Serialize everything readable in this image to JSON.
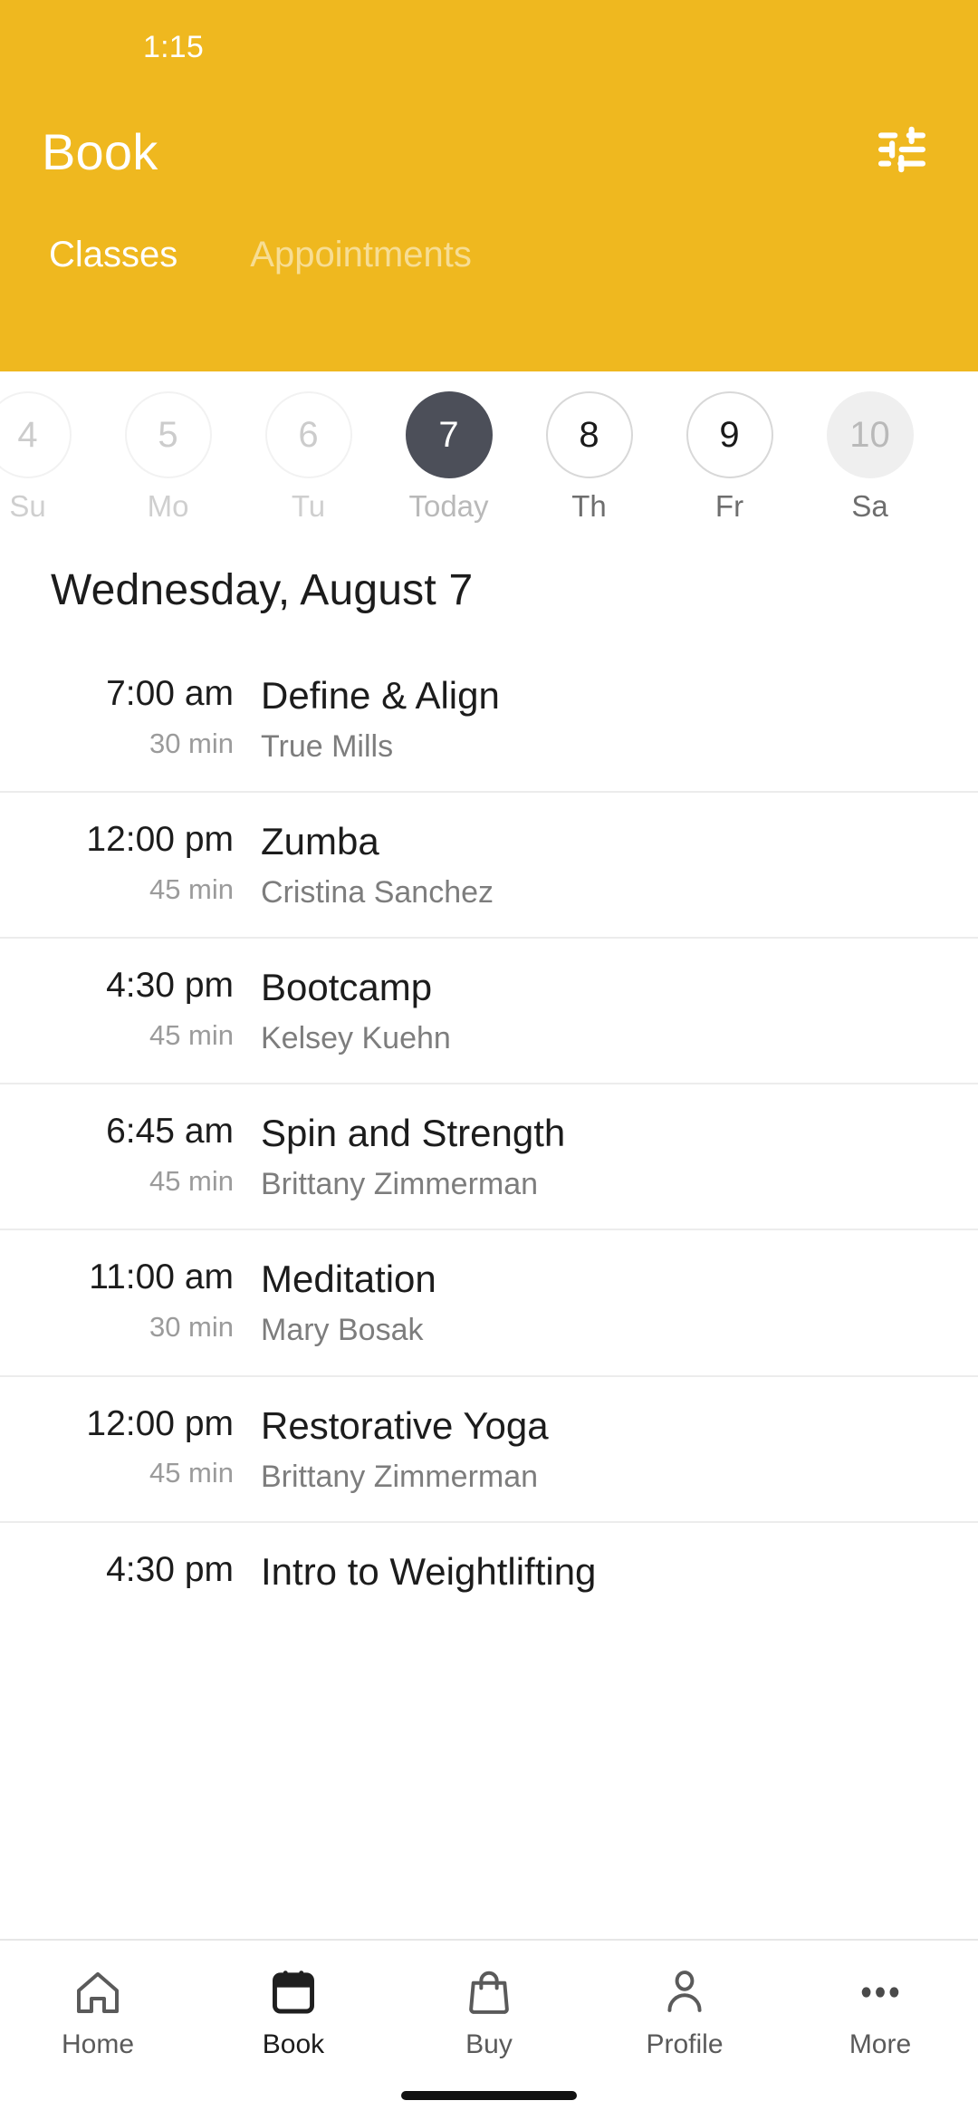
{
  "status_bar": {
    "time": "1:15"
  },
  "header": {
    "title": "Book",
    "accent_color": "#EFB81F",
    "filter_icon": "filter-tune-icon",
    "tabs": [
      {
        "label": "Classes",
        "active": true
      },
      {
        "label": "Appointments",
        "active": false
      }
    ]
  },
  "date_strip": {
    "days": [
      {
        "date": "4",
        "weekday": "Su",
        "state": "past"
      },
      {
        "date": "5",
        "weekday": "Mo",
        "state": "past"
      },
      {
        "date": "6",
        "weekday": "Tu",
        "state": "past"
      },
      {
        "date": "7",
        "weekday": "Today",
        "state": "selected"
      },
      {
        "date": "8",
        "weekday": "Th",
        "state": "available"
      },
      {
        "date": "9",
        "weekday": "Fr",
        "state": "available"
      },
      {
        "date": "10",
        "weekday": "Sa",
        "state": "muted"
      }
    ],
    "selected_color": "#4C4F59"
  },
  "schedule": {
    "heading": "Wednesday, August 7",
    "classes": [
      {
        "time": "7:00 am",
        "duration": "30 min",
        "name": "Define & Align",
        "instructor": "True Mills"
      },
      {
        "time": "12:00 pm",
        "duration": "45 min",
        "name": "Zumba",
        "instructor": "Cristina Sanchez"
      },
      {
        "time": "4:30 pm",
        "duration": "45 min",
        "name": "Bootcamp",
        "instructor": "Kelsey Kuehn"
      },
      {
        "time": "6:45 am",
        "duration": "45 min",
        "name": "Spin and Strength",
        "instructor": "Brittany Zimmerman"
      },
      {
        "time": "11:00 am",
        "duration": "30 min",
        "name": "Meditation",
        "instructor": "Mary Bosak"
      },
      {
        "time": "12:00 pm",
        "duration": "45 min",
        "name": "Restorative Yoga",
        "instructor": "Brittany Zimmerman"
      },
      {
        "time": "4:30 pm",
        "duration": "",
        "name": "Intro to Weightlifting",
        "instructor": ""
      }
    ]
  },
  "bottom_nav": {
    "items": [
      {
        "label": "Home",
        "icon": "home-icon",
        "active": false
      },
      {
        "label": "Book",
        "icon": "calendar-icon",
        "active": true
      },
      {
        "label": "Buy",
        "icon": "bag-icon",
        "active": false
      },
      {
        "label": "Profile",
        "icon": "person-icon",
        "active": false
      },
      {
        "label": "More",
        "icon": "ellipsis-icon",
        "active": false
      }
    ]
  }
}
